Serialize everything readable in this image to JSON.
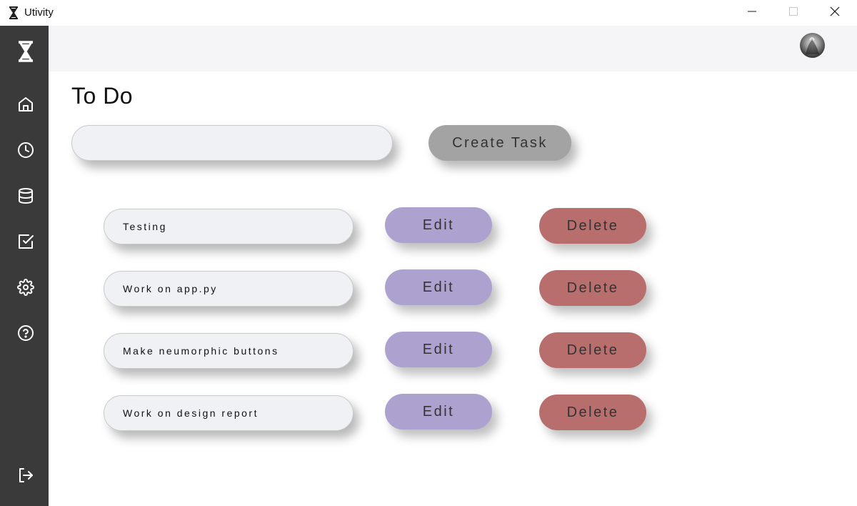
{
  "window": {
    "title": "Utivity",
    "app_icon": "hourglass-icon",
    "controls": [
      "minimize-icon",
      "maximize-icon",
      "close-icon"
    ]
  },
  "sidebar": {
    "background": "#3a3a3a",
    "logo_icon": "hourglass-icon",
    "items": [
      {
        "icon": "home-icon"
      },
      {
        "icon": "clock-icon"
      },
      {
        "icon": "database-icon"
      },
      {
        "icon": "checkbox-icon"
      },
      {
        "icon": "gear-icon"
      },
      {
        "icon": "help-icon"
      }
    ],
    "logout_icon": "logout-icon"
  },
  "header": {
    "avatar_icon": "avatar"
  },
  "page": {
    "title": "To Do"
  },
  "new_task": {
    "input_value": "",
    "input_placeholder": "",
    "create_label": "Create Task"
  },
  "tasks": [
    {
      "text": "Testing",
      "edit_label": "Edit",
      "delete_label": "Delete"
    },
    {
      "text": "Work on app.py",
      "edit_label": "Edit",
      "delete_label": "Delete"
    },
    {
      "text": "Make neumorphic buttons",
      "edit_label": "Edit",
      "delete_label": "Delete"
    },
    {
      "text": "Work on design report",
      "edit_label": "Edit",
      "delete_label": "Delete"
    }
  ],
  "colors": {
    "edit": "#ada2cf",
    "delete": "#b96e6e",
    "create": "#a3a3a3",
    "field": "#f0f1f4"
  }
}
